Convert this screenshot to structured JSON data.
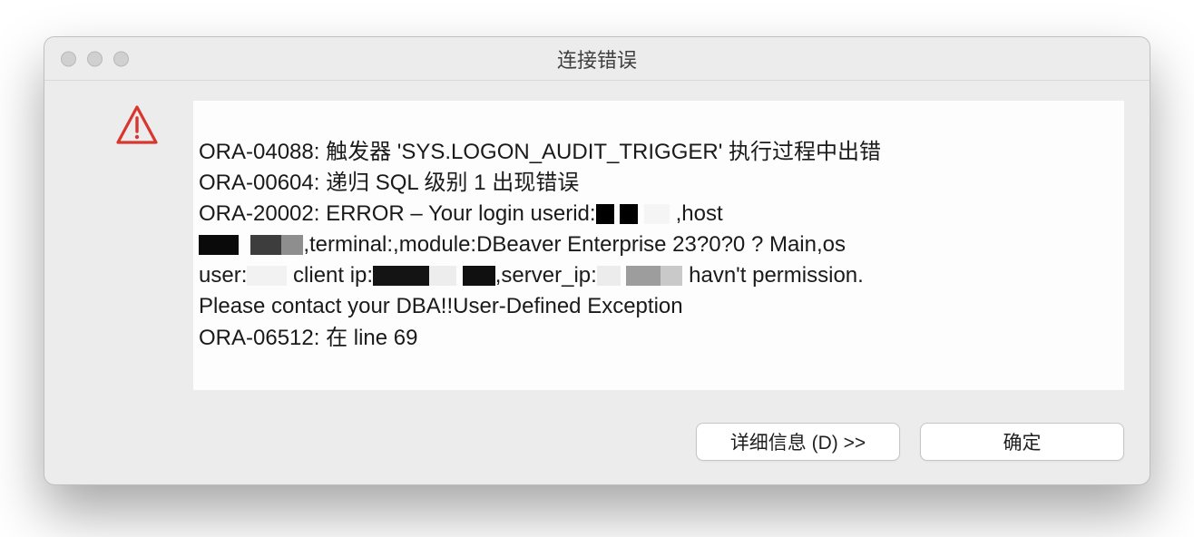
{
  "window": {
    "title": "连接错误"
  },
  "message": {
    "line1": "ORA-04088: 触发器 'SYS.LOGON_AUDIT_TRIGGER' 执行过程中出错",
    "line2": "ORA-00604: 递归 SQL 级别 1 出现错误",
    "line3_prefix": "ORA-20002: ERROR – Your login userid:",
    "line3_suffix": ",host",
    "line4_middle": ",terminal:,module:DBeaver Enterprise 23?0?0 ? Main,os",
    "line5_user_prefix": "user:",
    "line5_clientip_prefix": "client ip:",
    "line5_serverip_prefix": ",server_ip:",
    "line5_suffix": " havn't permission.",
    "line6": "Please contact your DBA!!User-Defined Exception",
    "line7": "ORA-06512: 在 line 69"
  },
  "buttons": {
    "details": "详细信息 (D) >>",
    "ok": "确定"
  }
}
